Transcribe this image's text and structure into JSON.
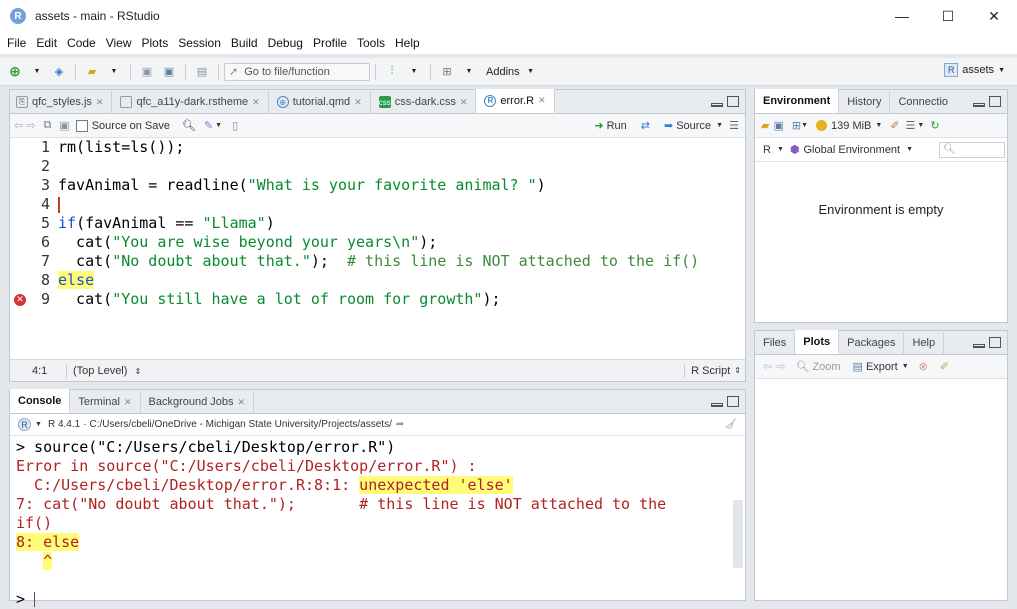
{
  "window": {
    "title": "assets - main - RStudio",
    "minimize": "—",
    "maximize": "☐",
    "close": "✕"
  },
  "menu": [
    "File",
    "Edit",
    "Code",
    "View",
    "Plots",
    "Session",
    "Build",
    "Debug",
    "Profile",
    "Tools",
    "Help"
  ],
  "toolbar": {
    "goto_placeholder": "Go to file/function",
    "addins": "Addins",
    "project": "assets"
  },
  "editor": {
    "tabs": [
      {
        "label": "qfc_styles.js",
        "icon": "js-file-icon"
      },
      {
        "label": "qfc_a11y-dark.rstheme",
        "icon": "file-icon"
      },
      {
        "label": "tutorial.qmd",
        "icon": "quarto-file-icon"
      },
      {
        "label": "css-dark.css",
        "icon": "css-file-icon"
      },
      {
        "label": "error.R",
        "icon": "r-file-icon",
        "active": true
      }
    ],
    "source_on_save": "Source on Save",
    "run": "Run",
    "source": "Source",
    "lines": [
      {
        "n": "1",
        "parts": [
          {
            "t": "rm(list=ls());",
            "c": "blk"
          }
        ]
      },
      {
        "n": "2",
        "parts": []
      },
      {
        "n": "3",
        "parts": [
          {
            "t": "favAnimal = readline(",
            "c": "blk"
          },
          {
            "t": "\"What is your favorite animal? \"",
            "c": "str"
          },
          {
            "t": ")",
            "c": "blk"
          }
        ]
      },
      {
        "n": "4",
        "parts": [],
        "cursor": true
      },
      {
        "n": "5",
        "parts": [
          {
            "t": "if",
            "c": "kw"
          },
          {
            "t": "(favAnimal == ",
            "c": "blk"
          },
          {
            "t": "\"Llama\"",
            "c": "str"
          },
          {
            "t": ")",
            "c": "blk"
          }
        ]
      },
      {
        "n": "6",
        "parts": [
          {
            "t": "  cat(",
            "c": "blk"
          },
          {
            "t": "\"You are wise beyond your years\\n\"",
            "c": "str"
          },
          {
            "t": ");",
            "c": "blk"
          }
        ]
      },
      {
        "n": "7",
        "parts": [
          {
            "t": "  cat(",
            "c": "blk"
          },
          {
            "t": "\"No doubt about that.\"",
            "c": "str"
          },
          {
            "t": ");  ",
            "c": "blk"
          },
          {
            "t": "# this line is NOT attached to the if()",
            "c": "cm"
          }
        ]
      },
      {
        "n": "8",
        "parts": [
          {
            "t": "else",
            "c": "kw hl"
          }
        ]
      },
      {
        "n": "9",
        "parts": [
          {
            "t": "  cat(",
            "c": "blk"
          },
          {
            "t": "\"You still have a lot of room for growth\"",
            "c": "str"
          },
          {
            "t": ");",
            "c": "blk"
          }
        ],
        "error": true
      }
    ],
    "status_pos": "4:1",
    "status_scope": "(Top Level)",
    "status_type": "R Script"
  },
  "console": {
    "tabs": [
      {
        "label": "Console",
        "active": true
      },
      {
        "label": "Terminal"
      },
      {
        "label": "Background Jobs"
      }
    ],
    "r_version": "R 4.4.1",
    "path": "C:/Users/cbeli/OneDrive - Michigan State University/Projects/assets/",
    "lines": [
      [
        {
          "t": "> source(\"C:/Users/cbeli/Desktop/error.R\")",
          "c": "blk"
        }
      ],
      [
        {
          "t": "Error in source(\"C:/Users/cbeli/Desktop/error.R\") : ",
          "c": "red"
        }
      ],
      [
        {
          "t": "  C:/Users/cbeli/Desktop/error.R:8:1: ",
          "c": "red"
        },
        {
          "t": "unexpected 'else'",
          "c": "red hl"
        }
      ],
      [
        {
          "t": "7: cat(\"No doubt about that.\");       # this line is NOT attached to the",
          "c": "red"
        }
      ],
      [
        {
          "t": "if()",
          "c": "red"
        }
      ],
      [
        {
          "t": "8: else",
          "c": "red hl"
        }
      ],
      [
        {
          "t": "   ",
          "c": "red"
        },
        {
          "t": "^",
          "c": "red hl"
        }
      ],
      [],
      [
        {
          "t": "> ",
          "c": "blk"
        }
      ]
    ]
  },
  "env": {
    "tabs": [
      {
        "label": "Environment",
        "active": true
      },
      {
        "label": "History"
      },
      {
        "label": "Connectio"
      }
    ],
    "memory": "139 MiB",
    "lang": "R",
    "scope": "Global Environment",
    "empty": "Environment is empty"
  },
  "files": {
    "tabs": [
      {
        "label": "Files"
      },
      {
        "label": "Plots",
        "active": true
      },
      {
        "label": "Packages"
      },
      {
        "label": "Help"
      }
    ],
    "zoom": "Zoom",
    "export": "Export"
  },
  "colors": {
    "keyword": "#1a52c8",
    "string": "#0a8a2e",
    "error": "#b22222",
    "highlight": "#fffc7a"
  }
}
